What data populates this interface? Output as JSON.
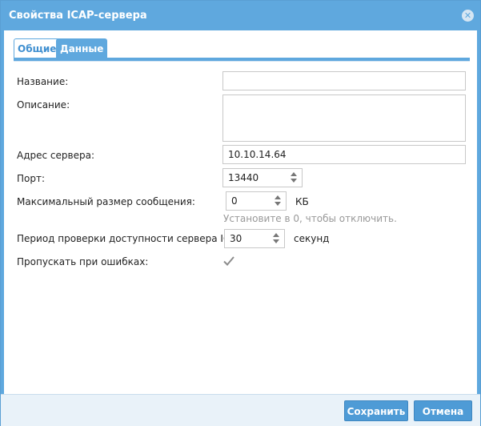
{
  "window": {
    "title": "Свойства ICAP-сервера"
  },
  "tabs": [
    {
      "label": "Общие",
      "active": true
    },
    {
      "label": "Данные",
      "active": false
    }
  ],
  "form": {
    "name": {
      "label": "Название:",
      "value": ""
    },
    "description": {
      "label": "Описание:",
      "value": ""
    },
    "server_address": {
      "label": "Адрес сервера:",
      "value": "10.10.14.64"
    },
    "port": {
      "label": "Порт:",
      "value": "13440"
    },
    "max_message_size": {
      "label": "Максимальный размер сообщения:",
      "value": "0",
      "unit": "КБ",
      "hint": "Установите в 0, чтобы отключить."
    },
    "availability_check": {
      "label": "Период проверки доступности сервера ICAP:",
      "value": "30",
      "unit": "секунд"
    },
    "skip_on_errors": {
      "label": "Пропускать при ошибках:",
      "checked": true
    }
  },
  "footer": {
    "save_label": "Сохранить",
    "cancel_label": "Отмена"
  },
  "colors": {
    "accent": "#5fa8de",
    "active_tab_text": "#3f8fd0",
    "button": "#4e9bd6",
    "hint": "#999999"
  },
  "icons": {
    "close": "close-icon",
    "check": "checkmark-icon"
  }
}
